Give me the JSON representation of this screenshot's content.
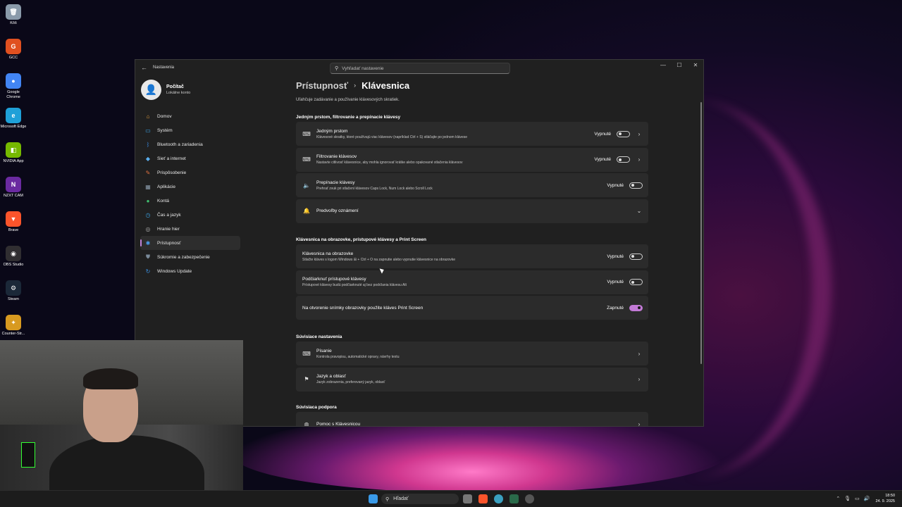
{
  "desktop": {
    "icons": [
      {
        "label": "Kôš",
        "icon": "recycle-bin-icon",
        "color": "#8a9aaa"
      },
      {
        "label": "GCC",
        "icon": "gcc-icon",
        "color": "#e05020"
      },
      {
        "label": "Google Chrome",
        "icon": "chrome-icon",
        "color": "#4285f4"
      },
      {
        "label": "Microsoft Edge",
        "icon": "edge-icon",
        "color": "#1fa0d8"
      },
      {
        "label": "NVIDIA App",
        "icon": "nvidia-icon",
        "color": "#76b900"
      },
      {
        "label": "NZXT CAM",
        "icon": "nzxt-icon",
        "color": "#6a2aa0"
      },
      {
        "label": "Brave",
        "icon": "brave-icon",
        "color": "#fb542b"
      },
      {
        "label": "OBS Studio",
        "icon": "obs-icon",
        "color": "#302e31"
      },
      {
        "label": "Steam",
        "icon": "steam-icon",
        "color": "#1b2838"
      },
      {
        "label": "Counter-Str...",
        "icon": "counter-strike-icon",
        "color": "#d89a20"
      }
    ]
  },
  "window": {
    "app_name": "Nastavenia",
    "search_placeholder": "Vyhľadať nastavenie",
    "profile": {
      "name": "Počítač",
      "sub": "Lokálne konto"
    },
    "nav": [
      {
        "label": "Domov",
        "icon": "home-icon",
        "color": "#e8a040"
      },
      {
        "label": "Systém",
        "icon": "system-icon",
        "color": "#3aa0e0"
      },
      {
        "label": "Bluetooth a zariadenia",
        "icon": "bluetooth-icon",
        "color": "#3a8ae0"
      },
      {
        "label": "Sieť a internet",
        "icon": "network-icon",
        "color": "#5ab0f0"
      },
      {
        "label": "Prispôsobenie",
        "icon": "brush-icon",
        "color": "#e07040"
      },
      {
        "label": "Aplikácie",
        "icon": "apps-icon",
        "color": "#8a9aaa"
      },
      {
        "label": "Kontá",
        "icon": "accounts-icon",
        "color": "#40c070"
      },
      {
        "label": "Čas a jazyk",
        "icon": "time-language-icon",
        "color": "#3aa0e0"
      },
      {
        "label": "Hranie hier",
        "icon": "gaming-icon",
        "color": "#aaaaaa"
      },
      {
        "label": "Prístupnosť",
        "icon": "accessibility-icon",
        "color": "#4aa0f0"
      },
      {
        "label": "Súkromie a zabezpečenie",
        "icon": "shield-icon",
        "color": "#7a8a9a"
      },
      {
        "label": "Windows Update",
        "icon": "update-icon",
        "color": "#3a90e0"
      }
    ],
    "active_nav": "Prístupnosť",
    "breadcrumb": {
      "parent": "Prístupnosť",
      "current": "Klávesnica"
    },
    "description": "Uľahčuje zadávanie a používanie klávesových skratiek.",
    "sections": [
      {
        "heading": "Jedným prstom, filtrovanie a prepínacie klávesy",
        "cards": [
          {
            "icon": "keyboard-icon",
            "title": "Jedným prstom",
            "sub": "Klávesové skratky, ktoré používajú viac klávesov (napríklad Ctrl + S) stláčajte po jednom klávese",
            "state": "Vypnuté",
            "toggle": false,
            "chevron": true
          },
          {
            "icon": "keyboard-icon",
            "title": "Filtrovanie klávesov",
            "sub": "Nastavte citlivosť klávesnice, aby mohla ignorovať krátke alebo opakované stlačenia klávesov",
            "state": "Vypnuté",
            "toggle": false,
            "chevron": true
          },
          {
            "icon": "speaker-icon",
            "title": "Prepínacie klávesy",
            "sub": "Prehrať zvuk pri stlačení klávesov Caps Lock, Num Lock alebo Scroll Lock",
            "state": "Vypnuté",
            "toggle": false,
            "chevron": false
          },
          {
            "icon": "bell-icon",
            "title": "Predvoľby oznámení",
            "sub": "",
            "state": "",
            "toggle": null,
            "chevron": "down"
          }
        ]
      },
      {
        "heading": "Klávesnica na obrazovke, prístupové klávesy a Print Screen",
        "cards": [
          {
            "icon": "",
            "title": "Klávesnica na obrazovke",
            "sub": "Stlačte kláves s logom Windows ⊞ + Ctrl + O na zapnutie alebo vypnutie klávesnice na obrazovke",
            "state": "Vypnuté",
            "toggle": false,
            "chevron": false
          },
          {
            "icon": "",
            "title": "Podčiarknuť prístupové klávesy",
            "sub": "Prístupové klávesy budú podčiarknuté aj bez podržania klávesu Alt",
            "state": "Vypnuté",
            "toggle": false,
            "chevron": false
          },
          {
            "icon": "",
            "title": "Na otvorenie snímky obrazovky použite kláves Print Screen",
            "sub": "",
            "state": "Zapnuté",
            "toggle": true,
            "chevron": false
          }
        ]
      },
      {
        "heading": "Súvisiace nastavenia",
        "cards": [
          {
            "icon": "keyboard-icon",
            "title": "Písanie",
            "sub": "Kontrola pravopisu, automatické opravy, návrhy textu",
            "state": "",
            "toggle": null,
            "chevron": true
          },
          {
            "icon": "language-icon",
            "title": "Jazyk a oblasť",
            "sub": "Jazyk zobrazenia, preferovaný jazyk, oblasť",
            "state": "",
            "toggle": null,
            "chevron": true
          }
        ]
      },
      {
        "heading": "Súvisiaca podpora",
        "cards": [
          {
            "icon": "globe-icon",
            "title": "Pomoc s Klávesnicou",
            "sub": "",
            "state": "",
            "toggle": null,
            "chevron": true
          }
        ]
      }
    ]
  },
  "taskbar": {
    "search_label": "Hľadať",
    "time": "18:50",
    "date": "24. 9. 2025"
  },
  "colors": {
    "accent": "#c27ad6",
    "window_bg": "#202020",
    "card_bg": "#2b2b2b"
  }
}
